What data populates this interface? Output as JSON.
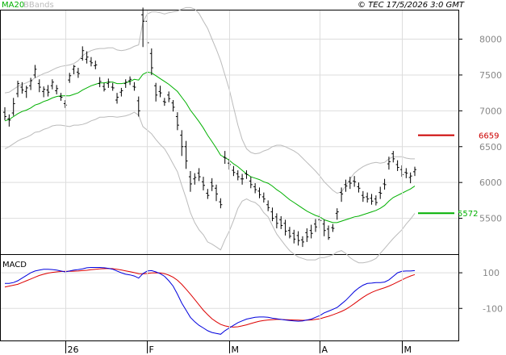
{
  "header": {
    "legend_ma": "MA20",
    "legend_bbands": "BBands",
    "copyright": "© TEC 17/5/2026 3:0 GMT",
    "macd_label": "MACD"
  },
  "colors": {
    "price": "#000000",
    "ma20": "#00b000",
    "bbands": "#bbbbbb",
    "resistance": "#cc0000",
    "support": "#00b000",
    "macd_line": "#0000dd",
    "signal_line": "#dd0000",
    "grid": "#dddddd"
  },
  "chart_data": [
    {
      "type": "ohlc",
      "panel": "price",
      "ylim": [
        5000,
        8400
      ],
      "yticks": [
        5500,
        6000,
        6500,
        7000,
        7500,
        8000
      ],
      "ytick_labels": [
        "5500",
        "6000",
        "6500",
        "7000",
        "7500",
        "8000"
      ],
      "xticks": [
        {
          "index": 14,
          "label": "26"
        },
        {
          "index": 33,
          "label": "F"
        },
        {
          "index": 52,
          "label": "M"
        },
        {
          "index": 73,
          "label": "A"
        },
        {
          "index": 92,
          "label": "M"
        }
      ],
      "levels": [
        {
          "name": "resistance",
          "value": 6659,
          "label": "6659"
        },
        {
          "name": "support",
          "value": 5572,
          "label": "5572"
        }
      ],
      "ohlc": [
        [
          6980,
          7050,
          6870,
          6920
        ],
        [
          6890,
          6950,
          6780,
          6870
        ],
        [
          6970,
          7180,
          6930,
          7100
        ],
        [
          7240,
          7420,
          7190,
          7380
        ],
        [
          7330,
          7400,
          7240,
          7290
        ],
        [
          7270,
          7350,
          7180,
          7320
        ],
        [
          7350,
          7460,
          7290,
          7420
        ],
        [
          7500,
          7640,
          7460,
          7580
        ],
        [
          7380,
          7440,
          7260,
          7330
        ],
        [
          7270,
          7340,
          7190,
          7300
        ],
        [
          7290,
          7360,
          7200,
          7260
        ],
        [
          7350,
          7440,
          7300,
          7400
        ],
        [
          7280,
          7360,
          7230,
          7310
        ],
        [
          7200,
          7250,
          7140,
          7190
        ],
        [
          7100,
          7150,
          7040,
          7080
        ],
        [
          7430,
          7530,
          7390,
          7490
        ],
        [
          7580,
          7640,
          7510,
          7620
        ],
        [
          7540,
          7600,
          7460,
          7520
        ],
        [
          7730,
          7900,
          7700,
          7840
        ],
        [
          7720,
          7830,
          7660,
          7750
        ],
        [
          7690,
          7750,
          7620,
          7670
        ],
        [
          7630,
          7700,
          7580,
          7640
        ],
        [
          7380,
          7470,
          7330,
          7410
        ],
        [
          7340,
          7390,
          7270,
          7300
        ],
        [
          7380,
          7450,
          7320,
          7400
        ],
        [
          7330,
          7390,
          7280,
          7320
        ],
        [
          7150,
          7250,
          7100,
          7190
        ],
        [
          7260,
          7320,
          7200,
          7280
        ],
        [
          7380,
          7440,
          7320,
          7400
        ],
        [
          7420,
          7480,
          7360,
          7440
        ],
        [
          7340,
          7400,
          7280,
          7330
        ],
        [
          7140,
          7200,
          6920,
          7000
        ],
        [
          8340,
          8440,
          7890,
          8250
        ],
        [
          8250,
          8300,
          7900,
          7950
        ],
        [
          7800,
          7870,
          7500,
          7600
        ],
        [
          7350,
          7390,
          7130,
          7220
        ],
        [
          7270,
          7350,
          7190,
          7250
        ],
        [
          7130,
          7180,
          7070,
          7120
        ],
        [
          7220,
          7270,
          7120,
          7170
        ],
        [
          7110,
          7150,
          6990,
          7050
        ],
        [
          6920,
          6980,
          6730,
          6800
        ],
        [
          6660,
          6730,
          6370,
          6500
        ],
        [
          6500,
          6580,
          6190,
          6300
        ],
        [
          6080,
          6160,
          5870,
          5980
        ],
        [
          6050,
          6130,
          5970,
          6070
        ],
        [
          6130,
          6200,
          6020,
          6080
        ],
        [
          6010,
          6080,
          5890,
          5960
        ],
        [
          5850,
          5910,
          5770,
          5820
        ],
        [
          6000,
          6060,
          5880,
          5950
        ],
        [
          5920,
          5970,
          5740,
          5840
        ],
        [
          5730,
          5780,
          5640,
          5690
        ],
        [
          6350,
          6440,
          6260,
          6340
        ],
        [
          6270,
          6330,
          6180,
          6250
        ],
        [
          6170,
          6230,
          6090,
          6140
        ],
        [
          6120,
          6170,
          6030,
          6080
        ],
        [
          6050,
          6120,
          5970,
          6050
        ],
        [
          6120,
          6170,
          6050,
          6110
        ],
        [
          6020,
          6080,
          5920,
          5970
        ],
        [
          5940,
          5990,
          5850,
          5900
        ],
        [
          5880,
          5930,
          5780,
          5830
        ],
        [
          5800,
          5860,
          5720,
          5770
        ],
        [
          5690,
          5750,
          5600,
          5650
        ],
        [
          5590,
          5650,
          5460,
          5500
        ],
        [
          5520,
          5570,
          5360,
          5430
        ],
        [
          5480,
          5530,
          5350,
          5400
        ],
        [
          5430,
          5480,
          5260,
          5320
        ],
        [
          5330,
          5380,
          5220,
          5250
        ],
        [
          5290,
          5340,
          5150,
          5210
        ],
        [
          5260,
          5320,
          5120,
          5190
        ],
        [
          5200,
          5250,
          5100,
          5170
        ],
        [
          5300,
          5360,
          5170,
          5240
        ],
        [
          5330,
          5410,
          5220,
          5290
        ],
        [
          5420,
          5490,
          5310,
          5380
        ],
        [
          5480,
          5560,
          5360,
          5470
        ],
        [
          5420,
          5480,
          5250,
          5330
        ],
        [
          5350,
          5400,
          5200,
          5230
        ],
        [
          5370,
          5420,
          5310,
          5360
        ],
        [
          5570,
          5640,
          5480,
          5590
        ],
        [
          5860,
          5930,
          5730,
          5840
        ],
        [
          5970,
          6040,
          5870,
          5950
        ],
        [
          6010,
          6080,
          5910,
          5990
        ],
        [
          6020,
          6090,
          5940,
          6010
        ],
        [
          5940,
          6000,
          5860,
          5920
        ],
        [
          5820,
          5880,
          5730,
          5790
        ],
        [
          5800,
          5860,
          5720,
          5770
        ],
        [
          5780,
          5840,
          5690,
          5740
        ],
        [
          5770,
          5820,
          5680,
          5720
        ],
        [
          5860,
          5940,
          5770,
          5850
        ],
        [
          5980,
          6050,
          5900,
          5970
        ],
        [
          6260,
          6360,
          6180,
          6290
        ],
        [
          6400,
          6440,
          6280,
          6330
        ],
        [
          6250,
          6310,
          6160,
          6210
        ],
        [
          6180,
          6240,
          6080,
          6110
        ],
        [
          6140,
          6200,
          6060,
          6130
        ],
        [
          6070,
          6140,
          5990,
          6090
        ],
        [
          6150,
          6220,
          6090,
          6180
        ]
      ],
      "ma20": [
        6860,
        6880,
        6920,
        6960,
        6990,
        7010,
        7040,
        7080,
        7100,
        7130,
        7150,
        7180,
        7200,
        7210,
        7210,
        7210,
        7230,
        7250,
        7290,
        7320,
        7350,
        7370,
        7390,
        7390,
        7400,
        7400,
        7380,
        7380,
        7390,
        7410,
        7440,
        7430,
        7510,
        7540,
        7530,
        7490,
        7450,
        7410,
        7370,
        7320,
        7270,
        7190,
        7110,
        7010,
        6930,
        6850,
        6760,
        6660,
        6570,
        6480,
        6380,
        6350,
        6310,
        6260,
        6220,
        6170,
        6120,
        6080,
        6060,
        6040,
        6010,
        5990,
        5950,
        5900,
        5860,
        5810,
        5760,
        5720,
        5680,
        5640,
        5600,
        5570,
        5540,
        5520,
        5480,
        5460,
        5440,
        5440,
        5460,
        5480,
        5500,
        5520,
        5530,
        5550,
        5570,
        5590,
        5610,
        5640,
        5680,
        5740,
        5790,
        5820,
        5850,
        5880,
        5910,
        5950
      ],
      "bb_upper": [
        7250,
        7260,
        7300,
        7340,
        7370,
        7390,
        7420,
        7460,
        7490,
        7520,
        7540,
        7570,
        7600,
        7620,
        7630,
        7640,
        7660,
        7700,
        7770,
        7810,
        7840,
        7860,
        7870,
        7870,
        7880,
        7880,
        7850,
        7840,
        7850,
        7870,
        7900,
        7920,
        8240,
        8350,
        8380,
        8380,
        8370,
        8350,
        8370,
        8380,
        8390,
        8420,
        8440,
        8440,
        8420,
        8360,
        8250,
        8150,
        8000,
        7860,
        7700,
        7500,
        7300,
        7050,
        6800,
        6600,
        6470,
        6420,
        6400,
        6410,
        6440,
        6460,
        6500,
        6520,
        6520,
        6500,
        6470,
        6440,
        6400,
        6340,
        6280,
        6220,
        6160,
        6090,
        6010,
        5950,
        5890,
        5850,
        5870,
        5950,
        6050,
        6130,
        6180,
        6220,
        6250,
        6270,
        6280,
        6270,
        6280,
        6330,
        6360,
        6360,
        6360,
        6340,
        6330,
        6330
      ],
      "bb_lower": [
        6470,
        6500,
        6540,
        6580,
        6610,
        6630,
        6660,
        6700,
        6710,
        6740,
        6760,
        6790,
        6800,
        6800,
        6790,
        6780,
        6800,
        6800,
        6810,
        6830,
        6860,
        6880,
        6910,
        6910,
        6920,
        6920,
        6910,
        6920,
        6930,
        6950,
        6980,
        6940,
        6780,
        6730,
        6680,
        6600,
        6530,
        6470,
        6370,
        6260,
        6150,
        5960,
        5780,
        5580,
        5440,
        5340,
        5270,
        5170,
        5140,
        5100,
        5060,
        5200,
        5320,
        5470,
        5640,
        5740,
        5770,
        5740,
        5720,
        5670,
        5580,
        5520,
        5400,
        5280,
        5200,
        5120,
        5050,
        5000,
        4960,
        4940,
        4920,
        4920,
        4920,
        4950,
        4950,
        4970,
        4990,
        5030,
        5050,
        5010,
        4950,
        4910,
        4880,
        4880,
        4890,
        4910,
        4940,
        5010,
        5080,
        5150,
        5220,
        5280,
        5340,
        5420,
        5490,
        5570
      ]
    },
    {
      "type": "line",
      "panel": "macd",
      "ylim": [
        -280,
        200
      ],
      "yticks": [
        100,
        -100
      ],
      "ytick_labels": [
        "100",
        "-100"
      ],
      "series": [
        {
          "name": "MACD",
          "values": [
            40,
            40,
            45,
            55,
            70,
            85,
            100,
            110,
            115,
            120,
            120,
            118,
            115,
            110,
            105,
            110,
            115,
            118,
            122,
            128,
            130,
            130,
            130,
            128,
            125,
            120,
            110,
            100,
            92,
            88,
            82,
            70,
            95,
            110,
            112,
            105,
            95,
            80,
            55,
            25,
            -20,
            -70,
            -110,
            -150,
            -175,
            -195,
            -210,
            -225,
            -235,
            -240,
            -245,
            -225,
            -210,
            -195,
            -180,
            -170,
            -160,
            -155,
            -150,
            -148,
            -148,
            -150,
            -155,
            -158,
            -162,
            -165,
            -168,
            -170,
            -172,
            -170,
            -165,
            -160,
            -150,
            -140,
            -125,
            -115,
            -105,
            -95,
            -75,
            -55,
            -30,
            -5,
            15,
            30,
            40,
            42,
            45,
            45,
            48,
            60,
            80,
            100,
            108,
            110,
            110,
            112
          ]
        },
        {
          "name": "Signal",
          "values": [
            20,
            25,
            30,
            35,
            45,
            55,
            65,
            75,
            85,
            92,
            98,
            102,
            105,
            107,
            108,
            108,
            109,
            110,
            112,
            114,
            117,
            120,
            122,
            123,
            124,
            123,
            120,
            116,
            111,
            106,
            101,
            95,
            94,
            96,
            99,
            100,
            99,
            95,
            87,
            75,
            58,
            35,
            8,
            -20,
            -50,
            -80,
            -110,
            -135,
            -158,
            -175,
            -190,
            -198,
            -203,
            -205,
            -203,
            -198,
            -192,
            -185,
            -178,
            -172,
            -168,
            -165,
            -163,
            -162,
            -162,
            -163,
            -164,
            -165,
            -166,
            -167,
            -166,
            -165,
            -162,
            -158,
            -151,
            -144,
            -136,
            -127,
            -117,
            -105,
            -90,
            -73,
            -55,
            -38,
            -23,
            -10,
            0,
            8,
            16,
            25,
            36,
            48,
            60,
            72,
            82,
            90
          ]
        }
      ]
    }
  ]
}
